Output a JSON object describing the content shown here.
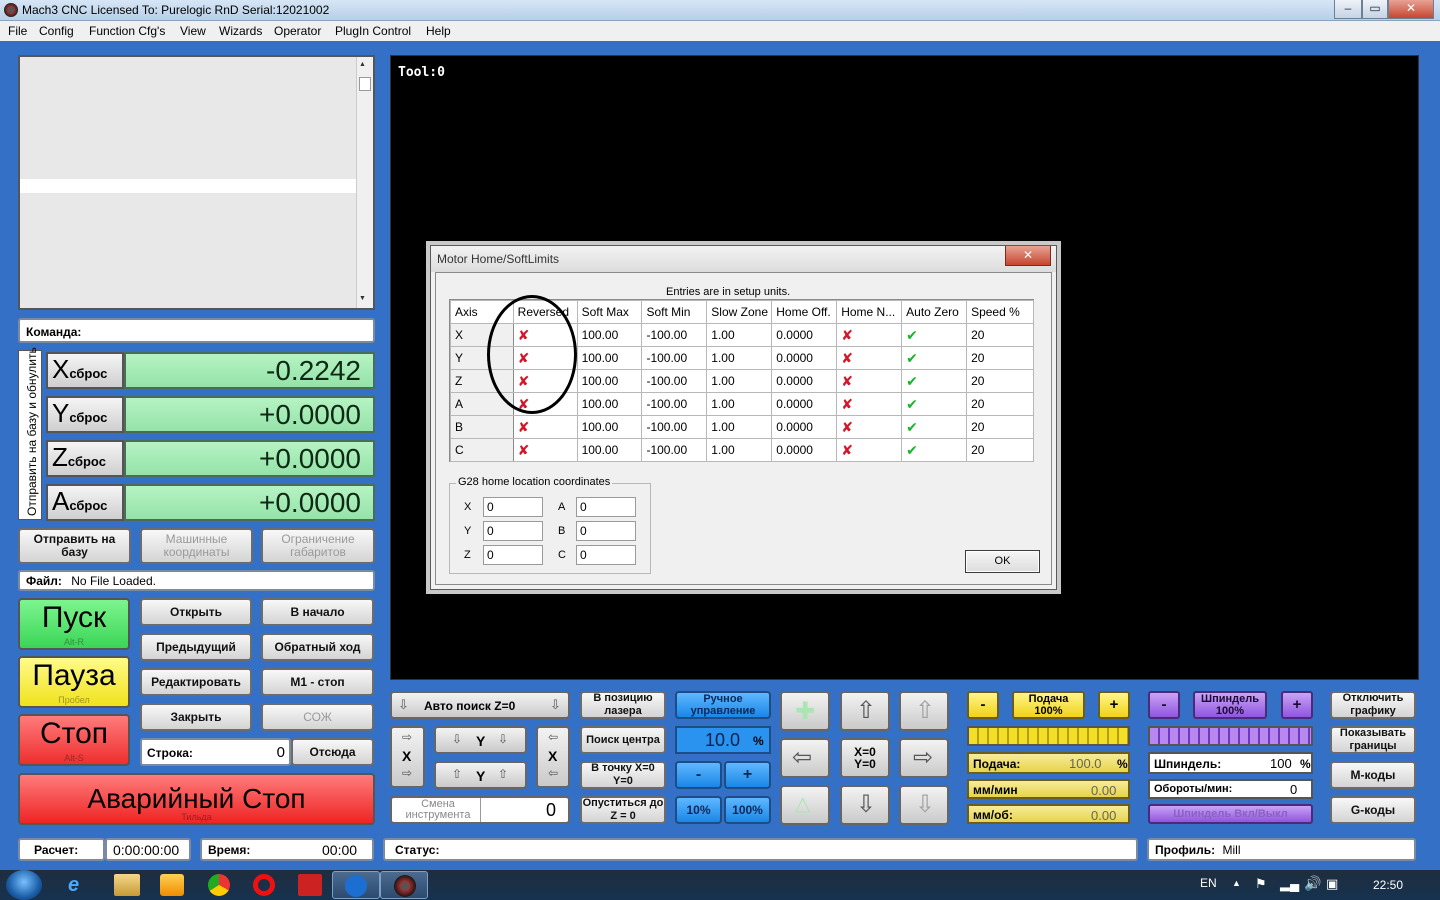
{
  "window": {
    "title": "Mach3 CNC  Licensed To: Purelogic RnD Serial:12021002",
    "min": "‒",
    "max": "▭",
    "close": "✕"
  },
  "menu": [
    "File",
    "Config",
    "Function Cfg's",
    "View",
    "Wizards",
    "Operator",
    "PlugIn Control",
    "Help"
  ],
  "command": {
    "label": "Команда:"
  },
  "ref_vertical_label": "Отправить на базу и обнулить",
  "dro": [
    {
      "axis": "X",
      "reset": "сброс",
      "value": "-0.2242"
    },
    {
      "axis": "Y",
      "reset": "сброс",
      "value": "+0.0000"
    },
    {
      "axis": "Z",
      "reset": "сброс",
      "value": "+0.0000"
    },
    {
      "axis": "A",
      "reset": "сброс",
      "value": "+0.0000"
    }
  ],
  "ref_buttons": {
    "home": "Отправить на базу",
    "machine": "Машинные координаты",
    "limits": "Ограничение габаритов"
  },
  "file": {
    "label": "Файл:",
    "value": "No File Loaded."
  },
  "cycle": {
    "start": "Пуск",
    "start_key": "Alt-R",
    "pause": "Пауза",
    "pause_key": "Пробел",
    "stop": "Стоп",
    "stop_key": "Alt-S",
    "estop": "Аварийный Стоп",
    "estop_key": "Тильда"
  },
  "program_buttons": {
    "open": "Открыть",
    "rewind": "В начало",
    "prev": "Предыдущий",
    "reverse": "Обратный ход",
    "edit": "Редактировать",
    "m1": "М1 - стоп",
    "close": "Закрыть",
    "coolant": "СОЖ",
    "line_label": "Строка:",
    "line_value": "0",
    "run_from": "Отсюда"
  },
  "display": {
    "tool": "Tool:0"
  },
  "jog": {
    "auto_z": "Авто поиск Z=0",
    "y_label": "Y",
    "x_label": "X",
    "tool_change": "Смена инструмента",
    "tool_value": "0",
    "laser_pos": "В позицию лазера",
    "find_center": "Поиск центра",
    "goto_zero": "В точку X=0 Y=0",
    "lower_z": "Опуститься до Z = 0",
    "manual": "Ручное управление",
    "step_value": "10.0",
    "step_unit": "%",
    "minus": "-",
    "plus": "+",
    "p10": "10%",
    "p100": "100%",
    "xy_zero": "X=0 Y=0"
  },
  "feed": {
    "minus": "-",
    "button": "Подача 100%",
    "plus": "+",
    "label": "Подача:",
    "value": "100.0",
    "unit": "%",
    "mm_min": "мм/мин",
    "mm_min_value": "0.00",
    "mm_rev": "мм/об:",
    "mm_rev_value": "0.00",
    "level": 1.0
  },
  "spindle": {
    "minus": "-",
    "button": "Шпиндель 100%",
    "plus": "+",
    "label": "Шпиндель:",
    "value": "100",
    "unit": "%",
    "rpm_label": "Обороты/мин:",
    "rpm_value": "0",
    "toggle": "Шпиндель Вкл/Выкл",
    "level": 1.0
  },
  "right_buttons": {
    "graphics": "Отключить графику",
    "bounds": "Показывать границы",
    "mcodes": "М-коды",
    "gcodes": "G-коды"
  },
  "statusbar": {
    "calc_label": "Расчет:",
    "calc_value": "0:00:00:00",
    "time_label": "Время:",
    "time_value": "00:00",
    "status_label": "Статус:",
    "profile_label": "Профиль:",
    "profile_value": "Mill"
  },
  "dialog": {
    "title": "Motor Home/SoftLimits",
    "close": "✕",
    "note": "Entries are in setup units.",
    "columns": [
      "Axis",
      "Reversed",
      "Soft Max",
      "Soft Min",
      "Slow Zone",
      "Home Off.",
      "Home N...",
      "Auto Zero",
      "Speed %"
    ],
    "rows": [
      {
        "axis": "X",
        "reversed": "✘",
        "max": "100.00",
        "min": "-100.00",
        "slow": "1.00",
        "off": "0.0000",
        "homeneg": "✘",
        "autozero": "✔",
        "speed": "20"
      },
      {
        "axis": "Y",
        "reversed": "✘",
        "max": "100.00",
        "min": "-100.00",
        "slow": "1.00",
        "off": "0.0000",
        "homeneg": "✘",
        "autozero": "✔",
        "speed": "20"
      },
      {
        "axis": "Z",
        "reversed": "✘",
        "max": "100.00",
        "min": "-100.00",
        "slow": "1.00",
        "off": "0.0000",
        "homeneg": "✘",
        "autozero": "✔",
        "speed": "20"
      },
      {
        "axis": "A",
        "reversed": "✘",
        "max": "100.00",
        "min": "-100.00",
        "slow": "1.00",
        "off": "0.0000",
        "homeneg": "✘",
        "autozero": "✔",
        "speed": "20"
      },
      {
        "axis": "B",
        "reversed": "✘",
        "max": "100.00",
        "min": "-100.00",
        "slow": "1.00",
        "off": "0.0000",
        "homeneg": "✘",
        "autozero": "✔",
        "speed": "20"
      },
      {
        "axis": "C",
        "reversed": "✘",
        "max": "100.00",
        "min": "-100.00",
        "slow": "1.00",
        "off": "0.0000",
        "homeneg": "✘",
        "autozero": "✔",
        "speed": "20"
      }
    ],
    "g28": {
      "legend": "G28 home location coordinates",
      "x_label": "X",
      "x": "0",
      "y_label": "Y",
      "y": "0",
      "z_label": "Z",
      "z": "0",
      "a_label": "A",
      "a": "0",
      "b_label": "B",
      "b": "0",
      "c_label": "C",
      "c": "0"
    },
    "ok": "OK"
  },
  "taskbar": {
    "lang": "EN",
    "clock": "22:50",
    "apps": [
      "start-orb-icon",
      "ie-icon",
      "explorer-icon",
      "media-player-icon",
      "chrome-icon",
      "opera-icon",
      "solidworks-icon",
      "teamviewer-icon",
      "mach3-icon"
    ]
  },
  "colors": {
    "main_bg": "#3471c6",
    "dro_green": "#a5ecb6",
    "start_green": "#4ee867",
    "pause_yellow": "#fff44a",
    "stop_red": "#ff3b3b",
    "jog_blue": "#2a93ef",
    "feed_yellow": "#f6dd2c",
    "spindle_purple": "#a56ee9"
  }
}
